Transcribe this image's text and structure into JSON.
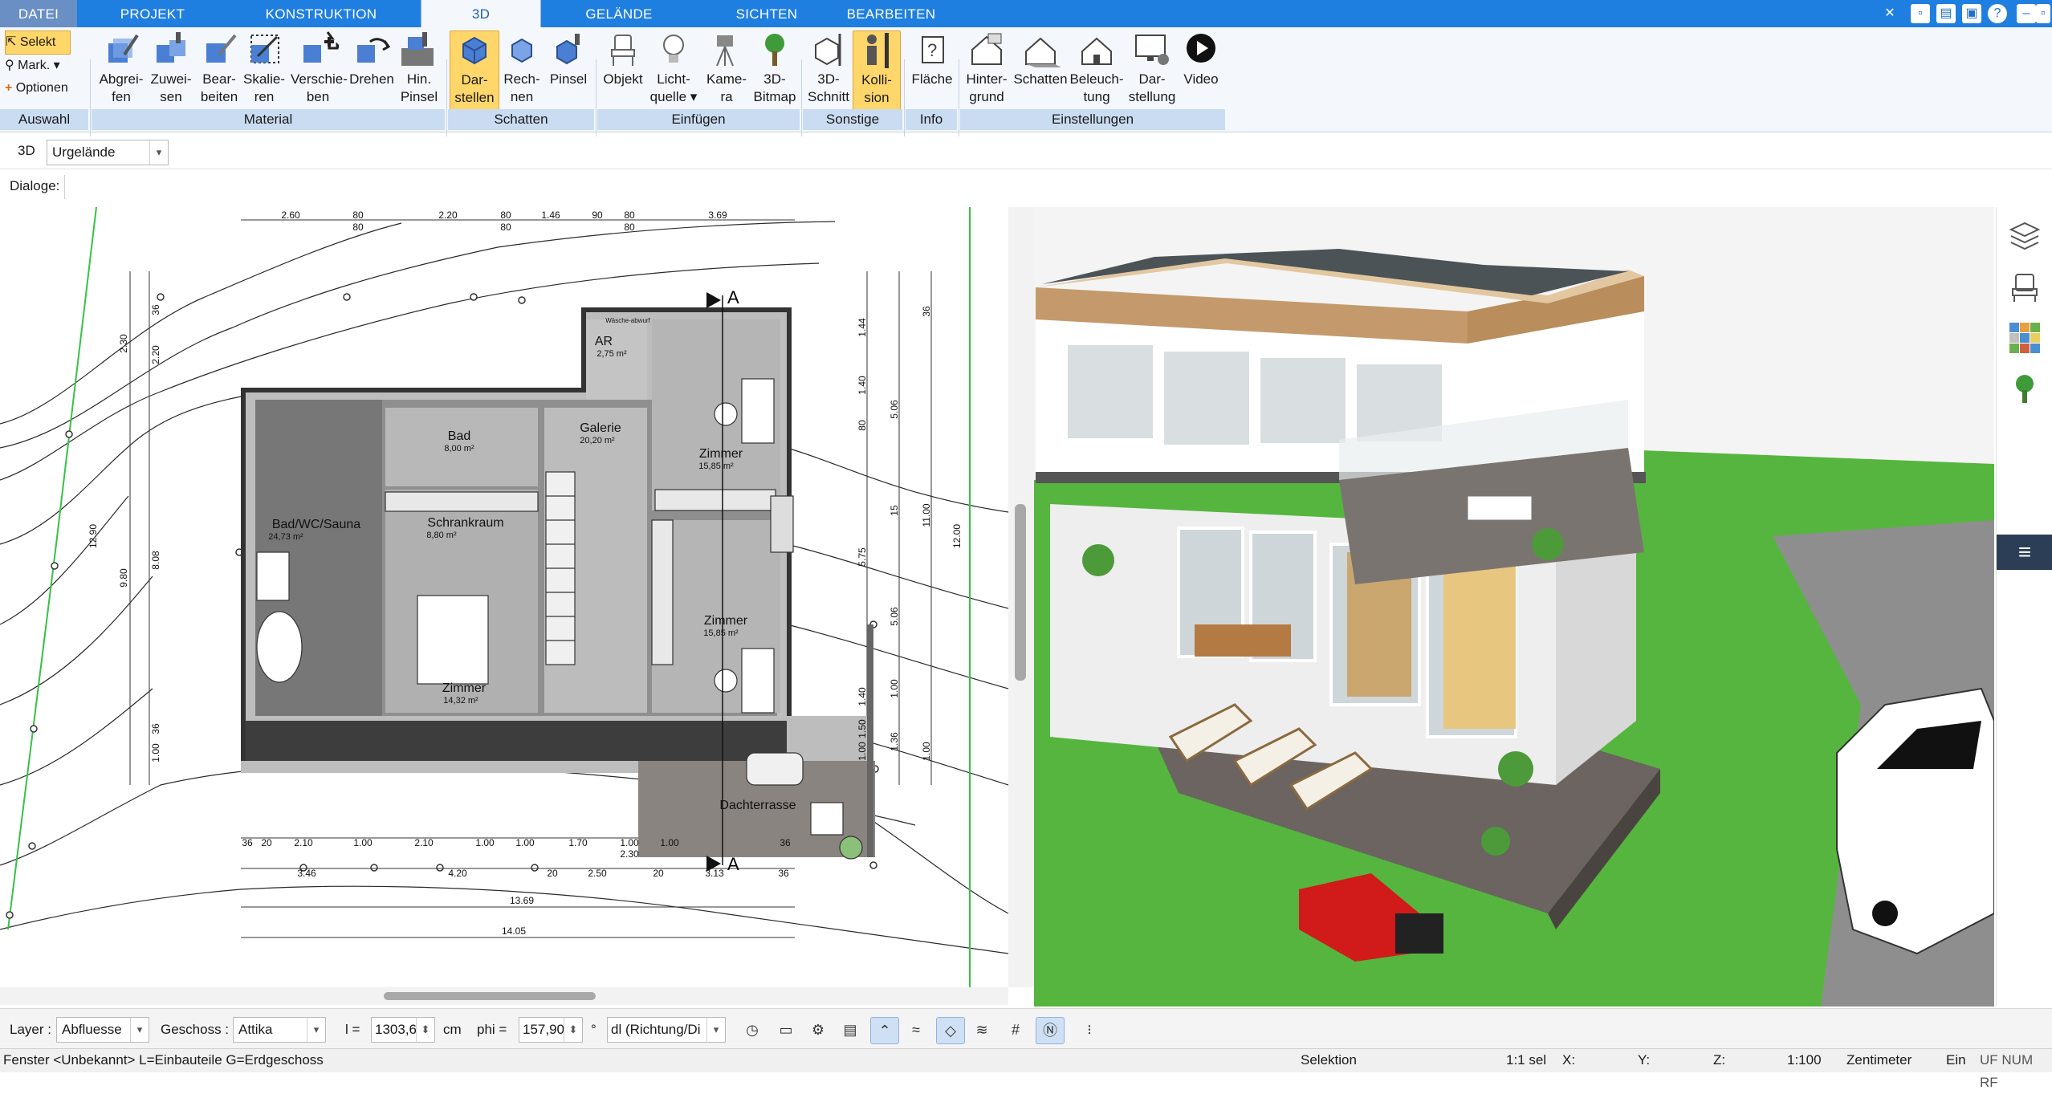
{
  "tabs": [
    "DATEI",
    "PROJEKT",
    "KONSTRUKTION",
    "3D",
    "GELÄNDE",
    "SICHTEN",
    "BEARBEITEN"
  ],
  "active_tab": "3D",
  "ribbon": {
    "left": {
      "select": "Selekt",
      "mark": "Mark.",
      "options": "Optionen"
    },
    "buttons": [
      {
        "l1": "Abgrei-",
        "l2": "fen"
      },
      {
        "l1": "Zuwei-",
        "l2": "sen"
      },
      {
        "l1": "Bear-",
        "l2": "beiten"
      },
      {
        "l1": "Skalie-",
        "l2": "ren"
      },
      {
        "l1": "Verschie-",
        "l2": "ben"
      },
      {
        "l1": "Drehen",
        "l2": ""
      },
      {
        "l1": "Hin.",
        "l2": "Pinsel"
      },
      {
        "l1": "Dar-",
        "l2": "stellen"
      },
      {
        "l1": "Rech-",
        "l2": "nen"
      },
      {
        "l1": "Pinsel",
        "l2": ""
      },
      {
        "l1": "Objekt",
        "l2": ""
      },
      {
        "l1": "Licht-",
        "l2": "quelle ▾"
      },
      {
        "l1": "Kame-",
        "l2": "ra"
      },
      {
        "l1": "3D-",
        "l2": "Bitmap"
      },
      {
        "l1": "3D-",
        "l2": "Schnitt"
      },
      {
        "l1": "Kolli-",
        "l2": "sion"
      },
      {
        "l1": "Fläche",
        "l2": ""
      },
      {
        "l1": "Hinter-",
        "l2": "grund"
      },
      {
        "l1": "Schatten",
        "l2": ""
      },
      {
        "l1": "Beleuch-",
        "l2": "tung"
      },
      {
        "l1": "Dar-",
        "l2": "stellung"
      },
      {
        "l1": "Video",
        "l2": ""
      }
    ],
    "groups": [
      "Auswahl",
      "Material",
      "Schatten",
      "Einfügen",
      "Sonstige",
      "Info",
      "Einstellungen"
    ]
  },
  "view_bar": {
    "mode": "3D",
    "terrain": "Urgelände"
  },
  "dialog_label": "Dialoge:",
  "plan": {
    "rooms": [
      {
        "name": "Bad",
        "area": "8,00 m²"
      },
      {
        "name": "Galerie",
        "area": "20,20 m²"
      },
      {
        "name": "Zimmer",
        "area": "15,85 m²"
      },
      {
        "name": "Bad/WC/Sauna",
        "area": "24,73 m²"
      },
      {
        "name": "Schrankraum",
        "area": "8,80 m²"
      },
      {
        "name": "Zimmer",
        "area": "15,85 m²"
      },
      {
        "name": "Zimmer",
        "area": "14,32 m²"
      },
      {
        "name": "AR",
        "area": "2,75 m²"
      },
      {
        "name": "Dachterrasse",
        "area": ""
      }
    ],
    "laundry_note": "Wäsche-abwurf",
    "dims_top": [
      "2.60",
      "80",
      "2.20",
      "80",
      "1.46",
      "90",
      "80",
      "3.69",
      "80",
      "80",
      "80"
    ],
    "dims_bottom1": [
      "36",
      "20",
      "2.10",
      "1.00",
      "2.10",
      "1.00",
      "1.00",
      "1.70",
      "1.00",
      "1.00",
      "36"
    ],
    "dims_bottom2": [
      "3.46",
      "4.20",
      "20",
      "2.50",
      "20",
      "3.13",
      "36",
      "2.30"
    ],
    "dims_bottom3": [
      "13.69",
      "14.05"
    ],
    "dims_left": [
      "2.30",
      "2.20",
      "36",
      "12.90",
      "9.80",
      "8.08",
      "36",
      "1.00"
    ],
    "dims_right": [
      "1.44",
      "1.40",
      "80",
      "5.06",
      "15",
      "5.75",
      "11.00",
      "12.00",
      "5.06",
      "1.40",
      "1.50",
      "1.36",
      "1.00",
      "1.00",
      "36",
      "1.00"
    ],
    "section_marker": "A"
  },
  "bottom": {
    "layer_label": "Layer :",
    "layer_value": "Abfluesse",
    "floor_label": "Geschoss :",
    "floor_value": "Attika",
    "l_label": "l =",
    "l_value": "1303,6",
    "l_unit": "cm",
    "phi_label": "phi =",
    "phi_value": "157,90",
    "phi_unit": "°",
    "dl_value": "dl (Richtung/Di"
  },
  "status": {
    "left": "Fenster <Unbekannt> L=Einbauteile G=Erdgeschoss",
    "selektion": "Selektion",
    "sel": "1:1 sel",
    "x": "X:",
    "y": "Y:",
    "z": "Z:",
    "scale": "1:100",
    "unit": "Zentimeter",
    "ein": "Ein",
    "flags": "UF NUM RF"
  },
  "colors": {
    "tab_blue": "#1f7fe0",
    "ribbon_bg": "#f4f7fc",
    "group_bg": "#c9dcf1",
    "selected": "#ffd66a",
    "grass": "#4fb53a",
    "deck": "#6b6460",
    "roof": "#4c5356"
  }
}
